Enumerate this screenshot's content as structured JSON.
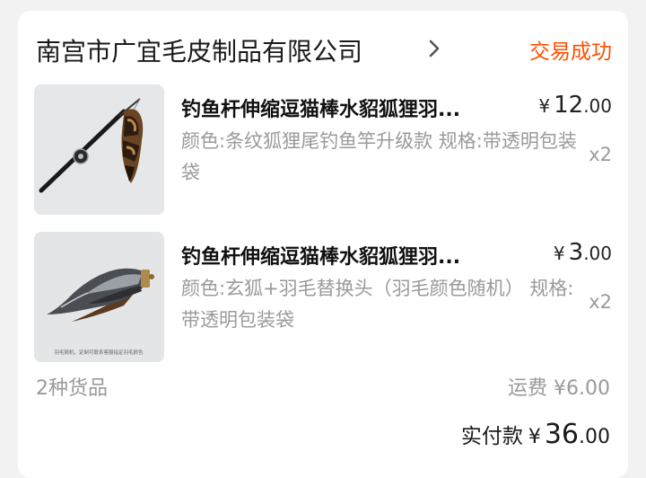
{
  "shop": {
    "name": "南宫市广宜毛皮制品有限公司",
    "status": "交易成功"
  },
  "items": [
    {
      "title": "钓鱼杆伸缩逗猫棒水貂狐狸羽...",
      "price_symbol": "¥",
      "price_int": "12",
      "price_dec": ".00",
      "spec": "颜色:条纹狐狸尾钓鱼竿升级款 规格:带透明包装袋",
      "qty": "x2"
    },
    {
      "title": "钓鱼杆伸缩逗猫棒水貂狐狸羽...",
      "price_symbol": "¥",
      "price_int": "3",
      "price_dec": ".00",
      "spec": "颜色:玄狐+羽毛替换头（羽毛颜色随机） 规格:带透明包装袋",
      "qty": "x2",
      "image_caption": "羽毛随机，定制可联系客服指定羽毛颜色"
    }
  ],
  "summary": {
    "count_text": "2种货品",
    "shipping_label": "运费",
    "shipping_symbol": "¥",
    "shipping_value": "6.00",
    "total_label": "实付款",
    "total_symbol": "¥",
    "total_int": "36",
    "total_dec": ".00"
  },
  "colors": {
    "accent": "#ff5000",
    "muted": "#9a9a9a",
    "background": "#f2f2f2"
  },
  "icons": {
    "shop_chevron": "chevron-right-icon"
  }
}
